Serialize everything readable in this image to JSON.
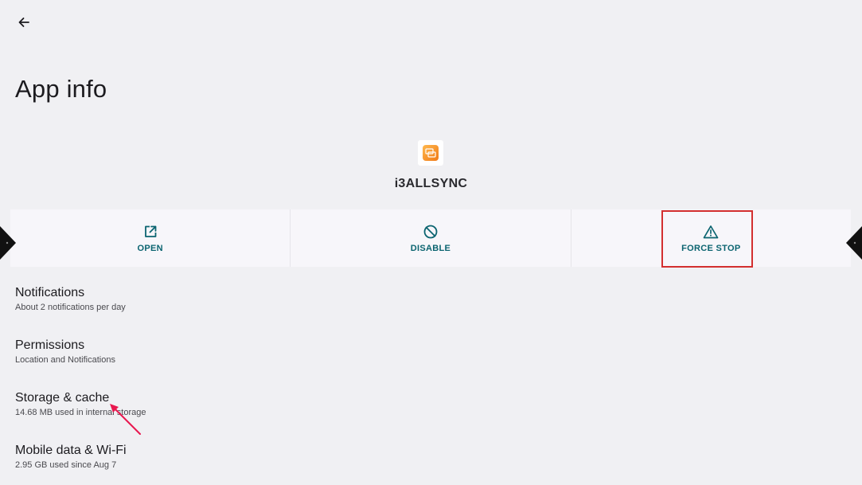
{
  "header": {
    "back_icon": "arrow-back-icon",
    "title": "App info"
  },
  "app": {
    "name": "i3ALLSYNC",
    "icon": "app-logo-icon",
    "icon_color": "#f5a623"
  },
  "actions": [
    {
      "label": "OPEN",
      "icon": "open-external-icon"
    },
    {
      "label": "DISABLE",
      "icon": "disable-icon"
    },
    {
      "label": "FORCE STOP",
      "icon": "warning-icon"
    }
  ],
  "settings": [
    {
      "title": "Notifications",
      "subtitle": "About 2 notifications per day"
    },
    {
      "title": "Permissions",
      "subtitle": "Location and Notifications"
    },
    {
      "title": "Storage & cache",
      "subtitle": "14.68 MB used in internal storage"
    },
    {
      "title": "Mobile data & Wi-Fi",
      "subtitle": "2.95 GB used since Aug 7"
    }
  ],
  "colors": {
    "accent": "#0b6470",
    "background": "#f0f0f3",
    "highlight": "#d32f2f",
    "annotation_arrow": "#e8184f"
  }
}
